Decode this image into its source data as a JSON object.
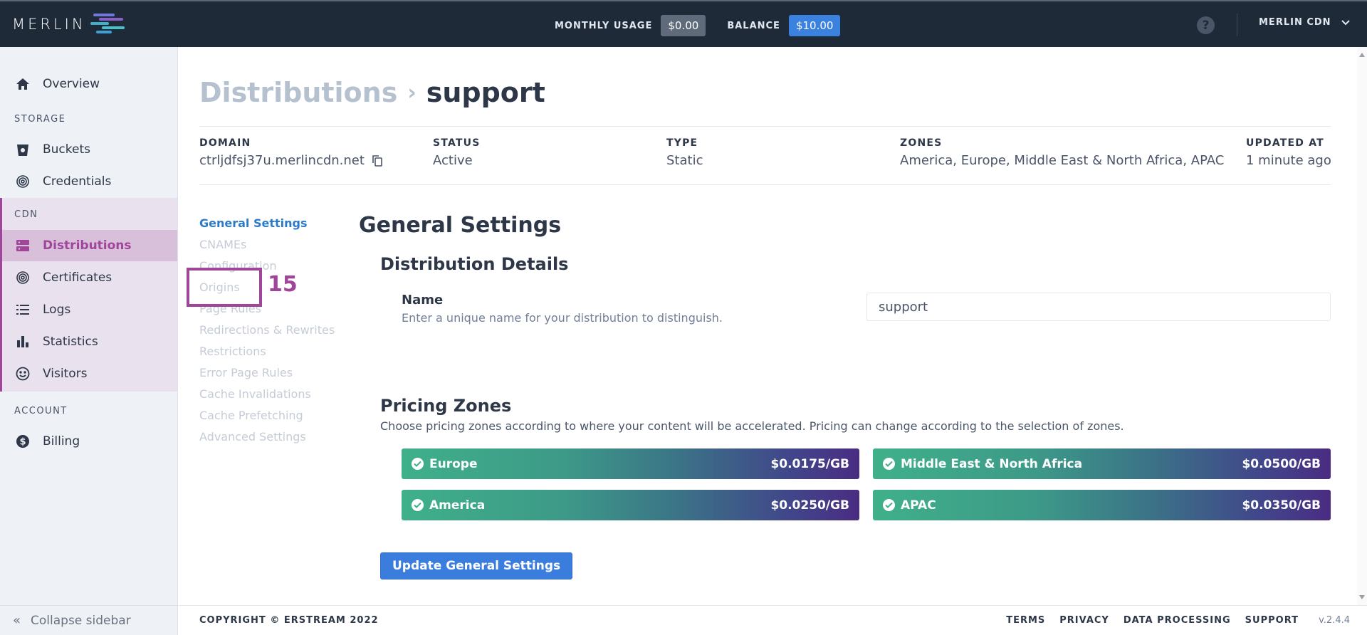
{
  "topbar": {
    "logo_text": "MERLIN",
    "monthly_usage_label": "MONTHLY USAGE",
    "monthly_usage_value": "$0.00",
    "balance_label": "BALANCE",
    "balance_value": "$10.00",
    "help_icon": "?",
    "account_name": "MERLIN CDN"
  },
  "sidebar": {
    "overview": "Overview",
    "storage_section": "STORAGE",
    "buckets": "Buckets",
    "credentials": "Credentials",
    "cdn_section": "CDN",
    "distributions": "Distributions",
    "certificates": "Certificates",
    "logs": "Logs",
    "statistics": "Statistics",
    "visitors": "Visitors",
    "account_section": "ACCOUNT",
    "billing": "Billing",
    "collapse": "Collapse sidebar"
  },
  "breadcrumb": {
    "parent": "Distributions",
    "separator": "›",
    "current": "support"
  },
  "meta": {
    "domain_label": "DOMAIN",
    "domain_value": "ctrljdfsj37u.merlincdn.net",
    "status_label": "STATUS",
    "status_value": "Active",
    "type_label": "TYPE",
    "type_value": "Static",
    "zones_label": "ZONES",
    "zones_value": "America, Europe, Middle East & North Africa, APAC",
    "updated_label": "UPDATED AT",
    "updated_value": "1 minute ago"
  },
  "subnav": [
    "General Settings",
    "CNAMEs",
    "Configuration",
    "Origins",
    "Page Rules",
    "Redirections & Rewrites",
    "Restrictions",
    "Error Page Rules",
    "Cache Invalidations",
    "Cache Prefetching",
    "Advanced Settings"
  ],
  "annotation": {
    "number": "15"
  },
  "content": {
    "title": "General Settings",
    "details_title": "Distribution Details",
    "name_label": "Name",
    "name_help": "Enter a unique name for your distribution to distinguish.",
    "name_value": "support",
    "pricing_title": "Pricing Zones",
    "pricing_help": "Choose pricing zones according to where your content will be accelerated. Pricing can change according to the selection of zones.",
    "zones": [
      {
        "name": "Europe",
        "price": "$0.0175/GB"
      },
      {
        "name": "Middle East & North Africa",
        "price": "$0.0500/GB"
      },
      {
        "name": "America",
        "price": "$0.0250/GB"
      },
      {
        "name": "APAC",
        "price": "$0.0350/GB"
      }
    ],
    "update_button": "Update General Settings"
  },
  "footer": {
    "copyright": "COPYRIGHT © ERSTREAM 2022",
    "terms": "TERMS",
    "privacy": "PRIVACY",
    "data_processing": "DATA PROCESSING",
    "support": "SUPPORT",
    "version": "v.2.4.4"
  },
  "colors": {
    "accent": "#a0469a",
    "link": "#2b7bc9",
    "primary_button": "#3b7ddd",
    "topbar": "#1e2a38"
  }
}
